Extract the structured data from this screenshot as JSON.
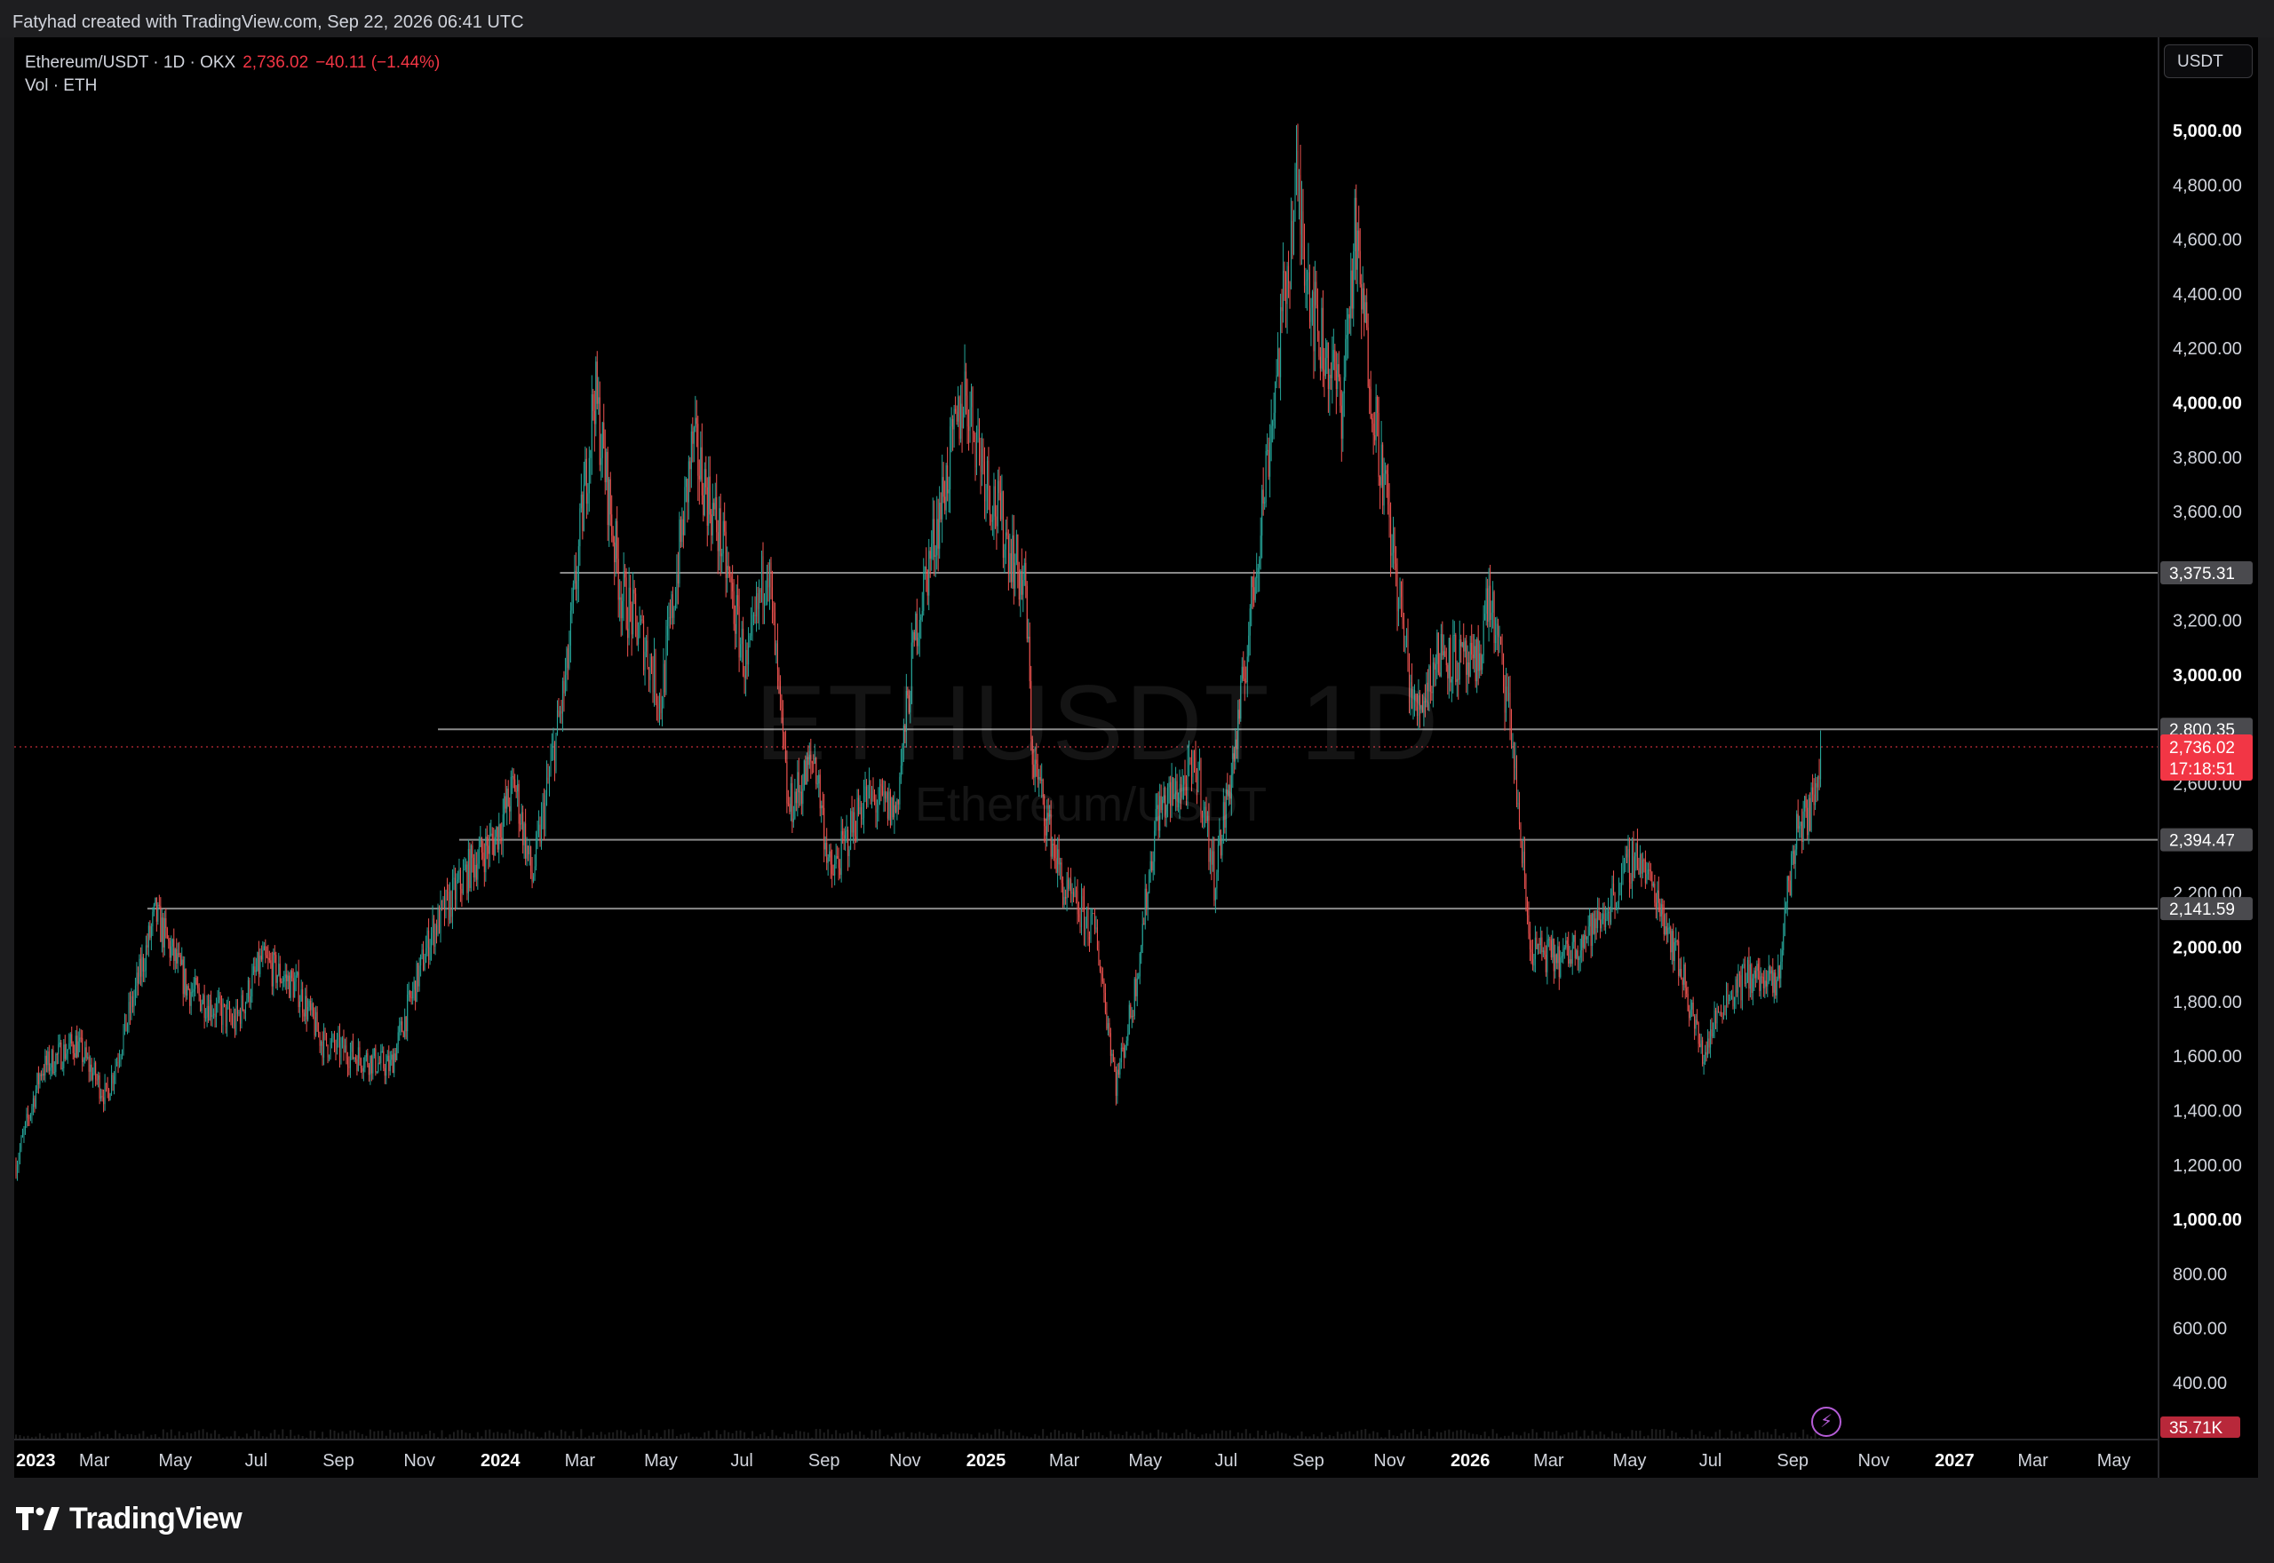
{
  "header": {
    "credit": "Fatyhad created with TradingView.com, Sep 22, 2026 06:41 UTC"
  },
  "legend": {
    "symbol": "Ethereum/USDT · 1D · OKX",
    "price": "2,736.02",
    "change": "−40.11 (−1.44%)",
    "volume_label": "Vol · ETH"
  },
  "currency_button": "USDT",
  "watermark": {
    "main": "ETHUSDT 1D",
    "sub": "Ethereum/USDT"
  },
  "branding": {
    "logo_text": "TradingView"
  },
  "icons": {
    "flash": "lightning-icon",
    "logo": "tradingview-logo-icon"
  },
  "colors": {
    "up": "#26a69a",
    "down": "#ef5350",
    "current_price": "#f23645",
    "level_line": "#8a8a8a",
    "background": "#000000"
  },
  "chart_data": {
    "type": "candlestick",
    "interval": "1D",
    "x_range": [
      "2023-01-01",
      "2027-06-01"
    ],
    "ylim": [
      200,
      5200
    ],
    "y_ticks": [
      "400.00",
      "600.00",
      "800.00",
      "1,000.00",
      "1,200.00",
      "1,400.00",
      "1,600.00",
      "1,800.00",
      "2,000.00",
      "2,200.00",
      "2,600.00",
      "2,800.00",
      "3,000.00",
      "3,200.00",
      "3,600.00",
      "3,800.00",
      "4,000.00",
      "4,200.00",
      "4,400.00",
      "4,600.00",
      "4,800.00",
      "5,000.00"
    ],
    "y_ticks_bold": [
      "1,000.00",
      "2,000.00",
      "3,000.00",
      "4,000.00",
      "5,000.00"
    ],
    "x_ticks": [
      {
        "label": "2023",
        "date": "2023-01-01",
        "bold": true
      },
      {
        "label": "Mar",
        "date": "2023-03-01"
      },
      {
        "label": "May",
        "date": "2023-05-01"
      },
      {
        "label": "Jul",
        "date": "2023-07-01"
      },
      {
        "label": "Sep",
        "date": "2023-09-01"
      },
      {
        "label": "Nov",
        "date": "2023-11-01"
      },
      {
        "label": "2024",
        "date": "2024-01-01",
        "bold": true
      },
      {
        "label": "Mar",
        "date": "2024-03-01"
      },
      {
        "label": "May",
        "date": "2024-05-01"
      },
      {
        "label": "Jul",
        "date": "2024-07-01"
      },
      {
        "label": "Sep",
        "date": "2024-09-01"
      },
      {
        "label": "Nov",
        "date": "2024-11-01"
      },
      {
        "label": "2025",
        "date": "2025-01-01",
        "bold": true
      },
      {
        "label": "Mar",
        "date": "2025-03-01"
      },
      {
        "label": "May",
        "date": "2025-05-01"
      },
      {
        "label": "Jul",
        "date": "2025-07-01"
      },
      {
        "label": "Sep",
        "date": "2025-09-01"
      },
      {
        "label": "Nov",
        "date": "2025-11-01"
      },
      {
        "label": "2026",
        "date": "2026-01-01",
        "bold": true
      },
      {
        "label": "Mar",
        "date": "2026-03-01"
      },
      {
        "label": "May",
        "date": "2026-05-01"
      },
      {
        "label": "Jul",
        "date": "2026-07-01"
      },
      {
        "label": "Sep",
        "date": "2026-09-01"
      },
      {
        "label": "Nov",
        "date": "2026-11-01"
      },
      {
        "label": "2027",
        "date": "2027-01-01",
        "bold": true
      },
      {
        "label": "Mar",
        "date": "2027-03-01"
      },
      {
        "label": "May",
        "date": "2027-05-01"
      }
    ],
    "horizontal_levels": [
      {
        "price": 3375.31,
        "label": "3,375.31",
        "from": "2024-02-15"
      },
      {
        "price": 2800.35,
        "label": "2,800.35",
        "from": "2023-11-15"
      },
      {
        "price": 2394.47,
        "label": "2,394.47",
        "from": "2023-12-01"
      },
      {
        "price": 2141.59,
        "label": "2,141.59",
        "from": "2023-04-10"
      }
    ],
    "current_price": {
      "price": 2736.02,
      "label": "2,736.02",
      "countdown": "17:18:51"
    },
    "volume_badge": "35.71K",
    "price_path": [
      [
        "2023-01-01",
        1200
      ],
      [
        "2023-01-20",
        1550
      ],
      [
        "2023-02-15",
        1650
      ],
      [
        "2023-03-10",
        1450
      ],
      [
        "2023-03-30",
        1800
      ],
      [
        "2023-04-16",
        2120
      ],
      [
        "2023-05-10",
        1850
      ],
      [
        "2023-06-15",
        1720
      ],
      [
        "2023-07-05",
        1950
      ],
      [
        "2023-08-01",
        1850
      ],
      [
        "2023-08-20",
        1650
      ],
      [
        "2023-09-15",
        1600
      ],
      [
        "2023-10-10",
        1560
      ],
      [
        "2023-10-25",
        1800
      ],
      [
        "2023-11-10",
        2050
      ],
      [
        "2023-12-10",
        2300
      ],
      [
        "2023-12-28",
        2400
      ],
      [
        "2024-01-12",
        2600
      ],
      [
        "2024-01-25",
        2250
      ],
      [
        "2024-02-20",
        3000
      ],
      [
        "2024-03-12",
        4050
      ],
      [
        "2024-04-01",
        3300
      ],
      [
        "2024-04-20",
        3100
      ],
      [
        "2024-05-01",
        2900
      ],
      [
        "2024-05-25",
        3850
      ],
      [
        "2024-06-15",
        3500
      ],
      [
        "2024-07-05",
        3000
      ],
      [
        "2024-07-20",
        3450
      ],
      [
        "2024-08-05",
        2500
      ],
      [
        "2024-08-25",
        2700
      ],
      [
        "2024-09-06",
        2250
      ],
      [
        "2024-10-01",
        2550
      ],
      [
        "2024-10-25",
        2500
      ],
      [
        "2024-11-10",
        3200
      ],
      [
        "2024-12-16",
        4050
      ],
      [
        "2025-01-06",
        3650
      ],
      [
        "2025-01-31",
        3300
      ],
      [
        "2025-02-05",
        2700
      ],
      [
        "2025-03-01",
        2200
      ],
      [
        "2025-03-25",
        2050
      ],
      [
        "2025-04-09",
        1500
      ],
      [
        "2025-04-22",
        1800
      ],
      [
        "2025-05-10",
        2500
      ],
      [
        "2025-06-10",
        2650
      ],
      [
        "2025-06-22",
        2250
      ],
      [
        "2025-07-10",
        2800
      ],
      [
        "2025-07-30",
        3700
      ],
      [
        "2025-08-23",
        4800
      ],
      [
        "2025-09-06",
        4300
      ],
      [
        "2025-09-26",
        4000
      ],
      [
        "2025-10-06",
        4600
      ],
      [
        "2025-10-20",
        4000
      ],
      [
        "2025-11-05",
        3400
      ],
      [
        "2025-11-20",
        2850
      ],
      [
        "2025-12-10",
        3100
      ],
      [
        "2026-01-05",
        3000
      ],
      [
        "2026-01-15",
        3300
      ],
      [
        "2026-02-01",
        2800
      ],
      [
        "2026-02-15",
        2000
      ],
      [
        "2026-03-10",
        1950
      ],
      [
        "2026-04-10",
        2100
      ],
      [
        "2026-05-06",
        2350
      ],
      [
        "2026-05-25",
        2150
      ],
      [
        "2026-06-10",
        1900
      ],
      [
        "2026-06-25",
        1600
      ],
      [
        "2026-07-10",
        1800
      ],
      [
        "2026-07-30",
        1900
      ],
      [
        "2026-08-20",
        1850
      ],
      [
        "2026-08-28",
        2200
      ],
      [
        "2026-09-05",
        2450
      ],
      [
        "2026-09-15",
        2500
      ],
      [
        "2026-09-22",
        2736
      ]
    ]
  }
}
